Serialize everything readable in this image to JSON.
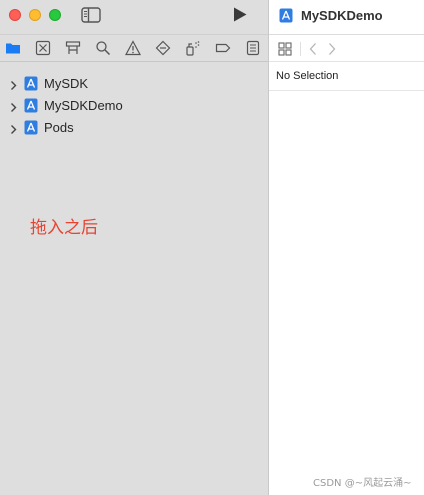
{
  "navigator": {
    "tree": [
      {
        "label": "MySDK",
        "icon": "xcode-project-icon"
      },
      {
        "label": "MySDKDemo",
        "icon": "xcode-project-icon"
      },
      {
        "label": "Pods",
        "icon": "xcode-project-icon"
      }
    ],
    "tabs": [
      "project-navigator",
      "source-control-navigator",
      "symbol-navigator",
      "find-navigator",
      "issue-navigator",
      "test-navigator",
      "debug-navigator",
      "breakpoint-navigator",
      "report-navigator"
    ]
  },
  "annotation": {
    "text": "拖入之后"
  },
  "editor": {
    "title": "MySDKDemo",
    "no_selection": "No Selection"
  },
  "watermark": {
    "text": "CSDN @~风起云涌~"
  },
  "colors": {
    "accent": "#1a7cf5",
    "annotation": "#e8432f"
  }
}
